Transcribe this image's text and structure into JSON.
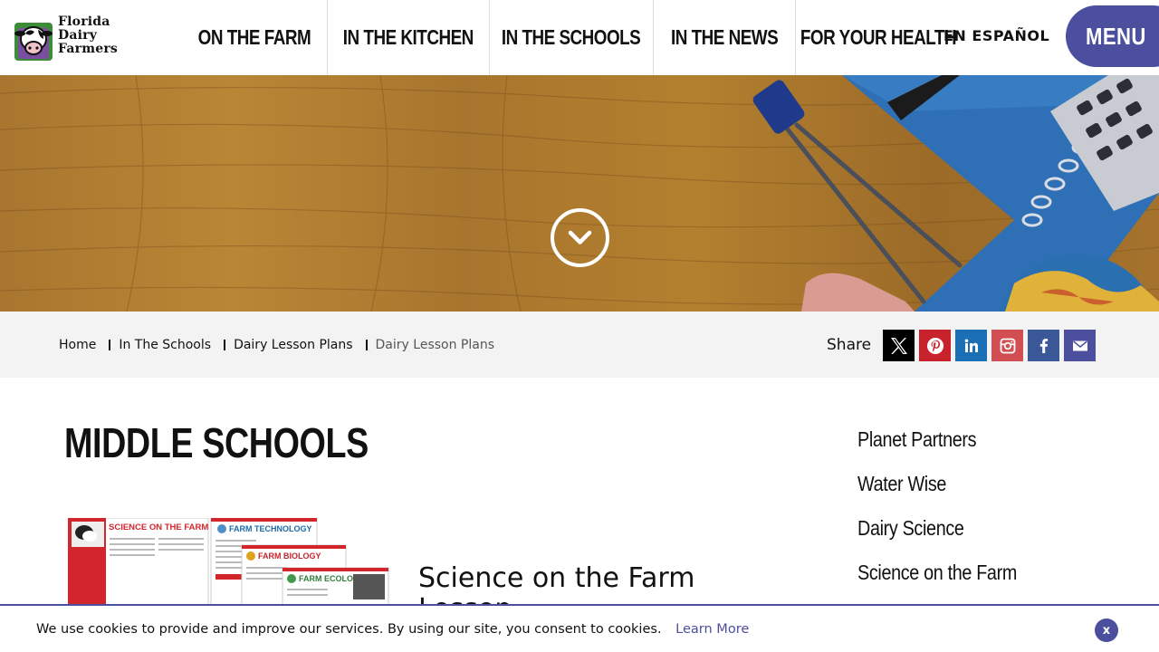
{
  "brand": {
    "logo_line1": "Florida",
    "logo_line2": "Dairy",
    "logo_line3": "Farmers",
    "accent_color": "#4b4f9e"
  },
  "nav": {
    "items": [
      {
        "label": "On The Farm"
      },
      {
        "label": "In The Kitchen"
      },
      {
        "label": "In The Schools"
      },
      {
        "label": "In The News"
      },
      {
        "label": "For Your Health"
      }
    ],
    "espanol": "EN ESPAÑOL",
    "menu": "MENU"
  },
  "hero": {
    "scroll_icon": "chevron-down-circle-icon"
  },
  "breadcrumb": {
    "items": [
      "Home",
      "In The Schools",
      "Dairy Lesson Plans"
    ],
    "current": "Dairy Lesson Plans"
  },
  "share": {
    "label": "Share",
    "icons": [
      {
        "name": "x-icon",
        "color": "#000000"
      },
      {
        "name": "pinterest-icon",
        "color": "#c8232c"
      },
      {
        "name": "linkedin-icon",
        "color": "#1b6fb5"
      },
      {
        "name": "instagram-icon",
        "color": "#d24e52"
      },
      {
        "name": "facebook-icon",
        "color": "#3b5998"
      },
      {
        "name": "email-icon",
        "color": "#4b4f9e"
      }
    ]
  },
  "main": {
    "title": "Middle Schools",
    "lesson_title": "Science on the Farm Lesson",
    "thumb_labels": {
      "a": "SCIENCE ON THE FARM",
      "b": "FARM TECHNOLOGY",
      "c": "FARM BIOLOGY",
      "d": "FARM ECOLOGY"
    }
  },
  "sidebar": {
    "items": [
      {
        "label": "Planet Partners"
      },
      {
        "label": "Water Wise"
      },
      {
        "label": "Dairy Science"
      },
      {
        "label": "Science on the Farm"
      }
    ]
  },
  "cookie": {
    "text": "We use cookies to provide and improve our services. By using our site, you consent to cookies.",
    "link": "Learn More",
    "close": "x"
  }
}
